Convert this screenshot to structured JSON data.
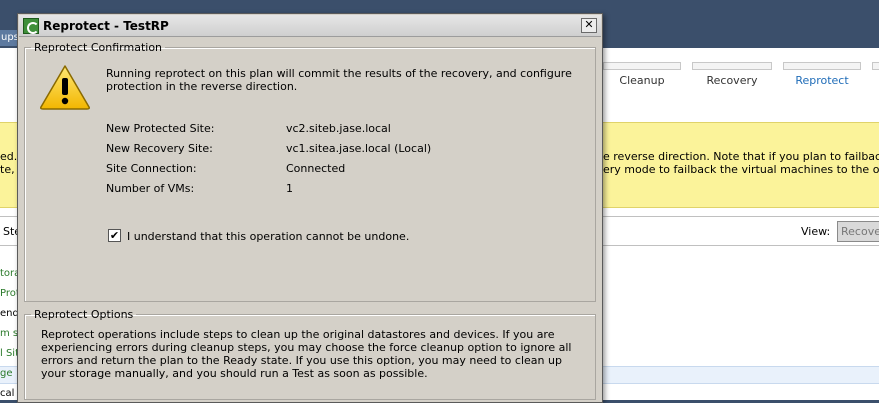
{
  "background": {
    "top_tab_fragment": "ups",
    "steps": [
      {
        "label": "Cleanup",
        "active": false
      },
      {
        "label": "Recovery",
        "active": false
      },
      {
        "label": "Reprotect",
        "active": true
      }
    ],
    "warning_left": [
      "ed.",
      "te,"
    ],
    "warning_right": [
      "e reverse direction. Note that if you plan to failback the vi",
      "ery mode to failback the virtual machines to the original si"
    ],
    "toolbar_left": "Ste",
    "view_label": "View:",
    "view_value": "Recover",
    "left_rows": [
      "tora",
      "Prot",
      "end",
      "m st",
      "l Sit",
      "ge",
      "cal V"
    ]
  },
  "dialog": {
    "title": "Reprotect - TestRP",
    "close_label": "✕",
    "confirm_legend": "Reprotect Confirmation",
    "confirm_message": "Running reprotect on this plan will commit the results of the recovery, and configure protection in the reverse direction.",
    "details": [
      {
        "label": "New Protected Site:",
        "value": "vc2.siteb.jase.local"
      },
      {
        "label": "New Recovery Site:",
        "value": "vc1.sitea.jase.local (Local)"
      },
      {
        "label": "Site Connection:",
        "value": "Connected"
      },
      {
        "label": "Number of VMs:",
        "value": "1"
      }
    ],
    "understand_checked": true,
    "checkbox_mark": "✔",
    "understand_label": "I understand that this operation cannot be undone.",
    "options_legend": "Reprotect Options",
    "options_text": "Reprotect operations include steps to clean up the original datastores and devices. If you are experiencing errors during cleanup steps, you may choose the force cleanup option to ignore all errors and return the plan to the Ready state. If you use this option, you may need to clean up your storage manually, and you should run a Test as soon as possible."
  }
}
